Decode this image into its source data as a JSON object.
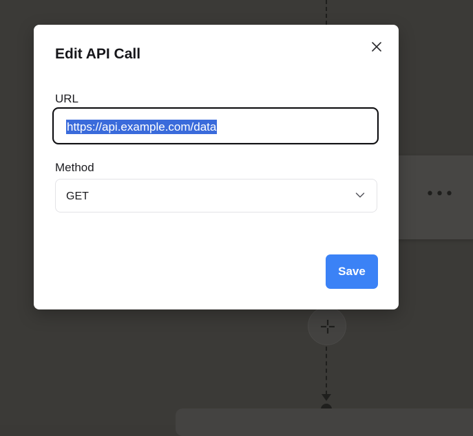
{
  "modal": {
    "title": "Edit API Call",
    "close_icon": "close-icon",
    "url": {
      "label": "URL",
      "value": "https://api.example.com/data",
      "selected": true
    },
    "method": {
      "label": "Method",
      "selected": "GET",
      "icon": "chevron-down-icon"
    },
    "save_label": "Save"
  },
  "background": {
    "node_menu_label": "•••",
    "add_step_icon": "plus-icon"
  },
  "colors": {
    "accent": "#3b82f6",
    "selection": "#3a6bdb",
    "backdrop": "#3b3a37",
    "modal_bg": "#ffffff"
  }
}
